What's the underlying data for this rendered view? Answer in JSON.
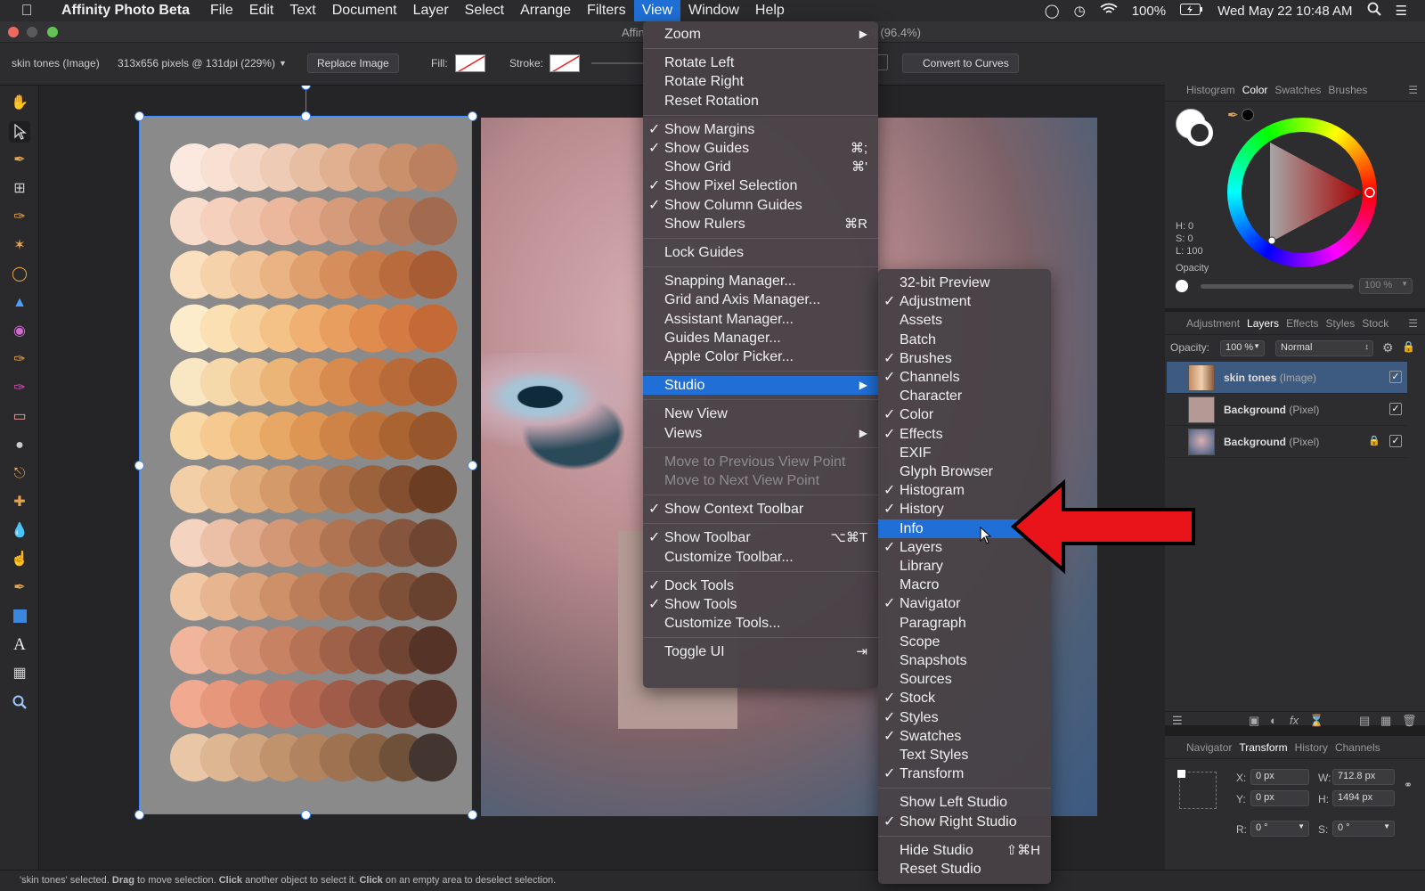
{
  "menubar": {
    "app_name": "Affinity Photo Beta",
    "items": [
      "File",
      "Edit",
      "Text",
      "Document",
      "Layer",
      "Select",
      "Arrange",
      "Filters",
      "View",
      "Window",
      "Help"
    ],
    "battery": "100%",
    "clock": "Wed May 22  10:48 AM"
  },
  "window": {
    "title_left": "Affin",
    "title_right": "d] (96.4%)"
  },
  "context_toolbar": {
    "layer_name": "skin tones (Image)",
    "image_info": "313x656 pixels @ 131dpi (229%)",
    "replace_button": "Replace Image",
    "fill_label": "Fill:",
    "stroke_label": "Stroke:",
    "convert_button": "Convert to Curves"
  },
  "tools": [
    "hand-tool-icon",
    "move-tool-icon",
    "color-picker-icon",
    "crop-tool-icon",
    "brush-selection-icon",
    "magic-wand-icon",
    "lasso-icon",
    "flood-fill-icon",
    "gradient-icon",
    "paint-brush-icon",
    "color-replace-icon",
    "eraser-icon",
    "dodge-icon",
    "clone-stamp-icon",
    "healing-brush-icon",
    "blur-icon",
    "smudge-icon",
    "pen-tool-icon",
    "rectangle-tool-icon",
    "text-tool-icon",
    "mesh-warp-icon",
    "zoom-tool-icon"
  ],
  "view_menu": {
    "items": [
      {
        "label": "Zoom",
        "submenu": true
      },
      {
        "sep": true
      },
      {
        "label": "Rotate Left"
      },
      {
        "label": "Rotate Right"
      },
      {
        "label": "Reset Rotation"
      },
      {
        "sep": true
      },
      {
        "label": "Show Margins",
        "checked": true
      },
      {
        "label": "Show Guides",
        "checked": true,
        "shortcut": "⌘;"
      },
      {
        "label": "Show Grid",
        "shortcut": "⌘'"
      },
      {
        "label": "Show Pixel Selection",
        "checked": true
      },
      {
        "label": "Show Column Guides",
        "checked": true
      },
      {
        "label": "Show Rulers",
        "shortcut": "⌘R"
      },
      {
        "sep": true
      },
      {
        "label": "Lock Guides"
      },
      {
        "sep": true
      },
      {
        "label": "Snapping Manager..."
      },
      {
        "label": "Grid and Axis Manager..."
      },
      {
        "label": "Assistant Manager..."
      },
      {
        "label": "Guides Manager..."
      },
      {
        "label": "Apple Color Picker..."
      },
      {
        "sep": true
      },
      {
        "label": "Studio",
        "submenu": true,
        "highlighted": true
      },
      {
        "sep": true
      },
      {
        "label": "New View"
      },
      {
        "label": "Views",
        "submenu": true
      },
      {
        "sep": true
      },
      {
        "label": "Move to Previous View Point",
        "disabled": true
      },
      {
        "label": "Move to Next View Point",
        "disabled": true
      },
      {
        "sep": true
      },
      {
        "label": "Show Context Toolbar",
        "checked": true
      },
      {
        "sep": true
      },
      {
        "label": "Show Toolbar",
        "checked": true,
        "shortcut": "⌥⌘T"
      },
      {
        "label": "Customize Toolbar..."
      },
      {
        "sep": true
      },
      {
        "label": "Dock Tools",
        "checked": true
      },
      {
        "label": "Show Tools",
        "checked": true
      },
      {
        "label": "Customize Tools..."
      },
      {
        "sep": true
      },
      {
        "label": "Toggle UI",
        "shortcut": "⇥"
      }
    ]
  },
  "studio_menu": {
    "items": [
      {
        "label": "32-bit Preview"
      },
      {
        "label": "Adjustment",
        "checked": true
      },
      {
        "label": "Assets"
      },
      {
        "label": "Batch"
      },
      {
        "label": "Brushes",
        "checked": true
      },
      {
        "label": "Channels",
        "checked": true
      },
      {
        "label": "Character"
      },
      {
        "label": "Color",
        "checked": true
      },
      {
        "label": "Effects",
        "checked": true
      },
      {
        "label": "EXIF"
      },
      {
        "label": "Glyph Browser"
      },
      {
        "label": "Histogram",
        "checked": true
      },
      {
        "label": "History",
        "checked": true
      },
      {
        "label": "Info",
        "highlighted": true
      },
      {
        "label": "Layers",
        "checked": true
      },
      {
        "label": "Library"
      },
      {
        "label": "Macro"
      },
      {
        "label": "Navigator",
        "checked": true
      },
      {
        "label": "Paragraph"
      },
      {
        "label": "Scope"
      },
      {
        "label": "Snapshots"
      },
      {
        "label": "Sources"
      },
      {
        "label": "Stock",
        "checked": true
      },
      {
        "label": "Styles",
        "checked": true
      },
      {
        "label": "Swatches",
        "checked": true
      },
      {
        "label": "Text Styles"
      },
      {
        "label": "Transform",
        "checked": true
      },
      {
        "sep": true
      },
      {
        "label": "Show Left Studio"
      },
      {
        "label": "Show Right Studio",
        "checked": true
      },
      {
        "sep": true
      },
      {
        "label": "Hide Studio",
        "shortcut": "⇧⌘H"
      },
      {
        "label": "Reset Studio"
      }
    ]
  },
  "color_panel": {
    "tabs": [
      "Histogram",
      "Color",
      "Swatches",
      "Brushes"
    ],
    "active_tab": "Color",
    "h": "H: 0",
    "s": "S: 0",
    "l": "L: 100",
    "opacity_label": "Opacity",
    "opacity_value": "100 %"
  },
  "layers_panel": {
    "tabs": [
      "Adjustment",
      "Layers",
      "Effects",
      "Styles",
      "Stock"
    ],
    "active_tab": "Layers",
    "opacity_label": "Opacity:",
    "opacity_value": "100 %",
    "blend_mode": "Normal",
    "layers": [
      {
        "name": "skin tones",
        "type": "(Image)",
        "selected": true,
        "locked": false
      },
      {
        "name": "Background",
        "type": "(Pixel)",
        "selected": false,
        "locked": false
      },
      {
        "name": "Background",
        "type": "(Pixel)",
        "selected": false,
        "locked": true
      }
    ]
  },
  "transform_panel": {
    "tabs": [
      "Navigator",
      "Transform",
      "History",
      "Channels"
    ],
    "active_tab": "Transform",
    "x_label": "X:",
    "x_value": "0 px",
    "y_label": "Y:",
    "y_value": "0 px",
    "w_label": "W:",
    "w_value": "712.8 px",
    "h_label": "H:",
    "h_value": "1494 px",
    "r_label": "R:",
    "r_value": "0 °",
    "s_label": "S:",
    "s_value": "0 °"
  },
  "status": {
    "p1": "'skin tones' selected. ",
    "b1": "Drag",
    "p2": " to move selection. ",
    "b2": "Click",
    "p3": " another object to select it. ",
    "b3": "Click",
    "p4": " on an empty area to deselect selection."
  },
  "colors": {
    "menu_highlight": "#1f6fd6",
    "arrow": "#e8141a",
    "selection": "#3d8bff"
  }
}
